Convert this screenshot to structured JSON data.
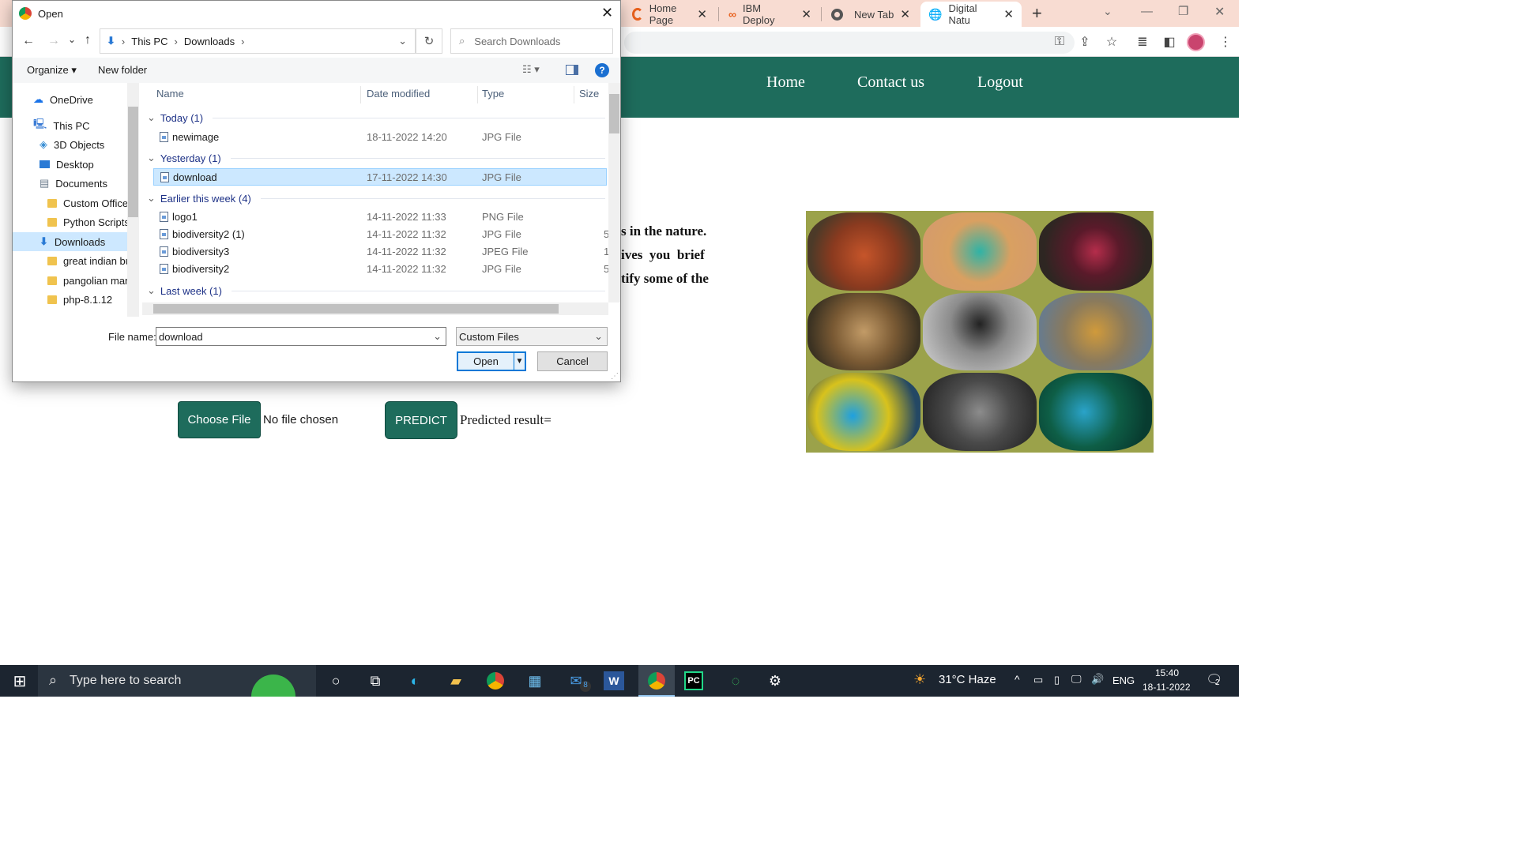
{
  "browser": {
    "tabs": [
      {
        "title": "Home Page"
      },
      {
        "title": "IBM Deploy"
      },
      {
        "title": "New Tab"
      },
      {
        "title": "Digital Natu"
      }
    ],
    "new_tab_symbol": "+"
  },
  "site": {
    "nav": {
      "home": "Home",
      "contact": "Contact us",
      "logout": "Logout"
    },
    "paragraph_lines": [
      "s in the nature.",
      "ives  you  brief",
      "tify some of the"
    ],
    "choose_file_label": "Choose File",
    "no_file_text": "No file chosen",
    "predict_label": "PREDICT",
    "predicted_result_label": "Predicted result="
  },
  "dialog": {
    "title": "Open",
    "breadcrumb": [
      "This PC",
      "Downloads"
    ],
    "search_placeholder": "Search Downloads",
    "organize_label": "Organize",
    "new_folder_label": "New folder",
    "columns": {
      "name": "Name",
      "date": "Date modified",
      "type": "Type",
      "size": "Size"
    },
    "nav_items": [
      {
        "label": "OneDrive",
        "icon": "cloud-icon"
      },
      {
        "label": "This PC",
        "icon": "computer-icon"
      },
      {
        "label": "3D Objects",
        "icon": "cube-icon"
      },
      {
        "label": "Desktop",
        "icon": "desktop-icon"
      },
      {
        "label": "Documents",
        "icon": "document-icon"
      },
      {
        "label": "Custom Office",
        "icon": "folder-icon"
      },
      {
        "label": "Python Scripts",
        "icon": "folder-icon"
      },
      {
        "label": "Downloads",
        "icon": "download-icon",
        "selected": true
      },
      {
        "label": "great indian bu",
        "icon": "folder-icon"
      },
      {
        "label": "pangolian man",
        "icon": "folder-icon"
      },
      {
        "label": "php-8.1.12",
        "icon": "folder-icon"
      }
    ],
    "groups": {
      "today": "Today (1)",
      "yesterday": "Yesterday (1)",
      "earlier": "Earlier this week (4)",
      "last_week": "Last week (1)"
    },
    "files": [
      {
        "name": "newimage",
        "date": "18-11-2022 14:20",
        "type": "JPG File",
        "size": ""
      },
      {
        "name": "download",
        "date": "17-11-2022 14:30",
        "type": "JPG File",
        "size": "",
        "selected": true
      },
      {
        "name": "logo1",
        "date": "14-11-2022 11:33",
        "type": "PNG File",
        "size": ""
      },
      {
        "name": "biodiversity2 (1)",
        "date": "14-11-2022 11:32",
        "type": "JPG File",
        "size": "5"
      },
      {
        "name": "biodiversity3",
        "date": "14-11-2022 11:32",
        "type": "JPEG File",
        "size": "1"
      },
      {
        "name": "biodiversity2",
        "date": "14-11-2022 11:32",
        "type": "JPG File",
        "size": "5"
      }
    ],
    "file_name_label": "File name:",
    "file_name_value": "download",
    "file_type_value": "Custom Files",
    "open_label": "Open",
    "cancel_label": "Cancel"
  },
  "taskbar": {
    "search_placeholder": "Type here to search",
    "weather": "31°C  Haze",
    "language": "ENG",
    "time": "15:40",
    "date": "18-11-2022",
    "mail_badge": "8",
    "notification_count": "2"
  },
  "colors": {
    "site_green": "#1e6c5c",
    "browser_tabbar": "#f8dcd2",
    "selection_blue": "#cce8ff"
  }
}
